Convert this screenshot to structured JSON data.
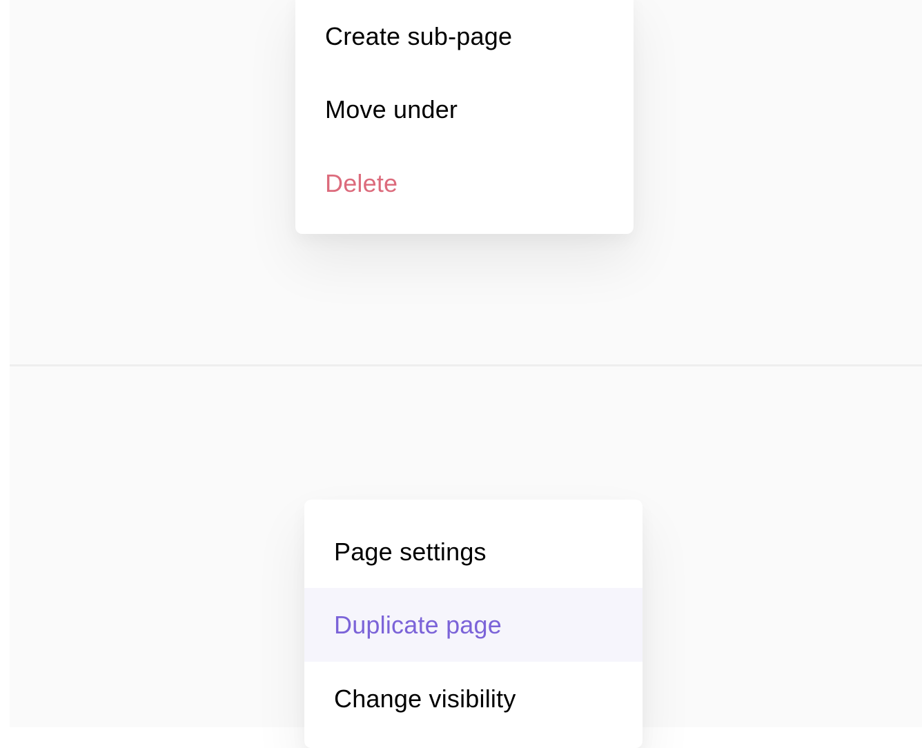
{
  "colors": {
    "background": "#fafafa",
    "menu_background": "#ffffff",
    "text": "#000000",
    "danger": "#dc6b7c",
    "highlight_text": "#7b63d8",
    "highlight_background": "#f6f5fc",
    "divider": "#eeeeee"
  },
  "top_menu": {
    "items": [
      {
        "label": "Create sub-page"
      },
      {
        "label": "Move under"
      },
      {
        "label": "Delete"
      }
    ]
  },
  "bottom_menu": {
    "items": [
      {
        "label": "Page settings"
      },
      {
        "label": "Duplicate page"
      },
      {
        "label": "Change visibility"
      }
    ],
    "highlighted_item": "Duplicate page"
  }
}
